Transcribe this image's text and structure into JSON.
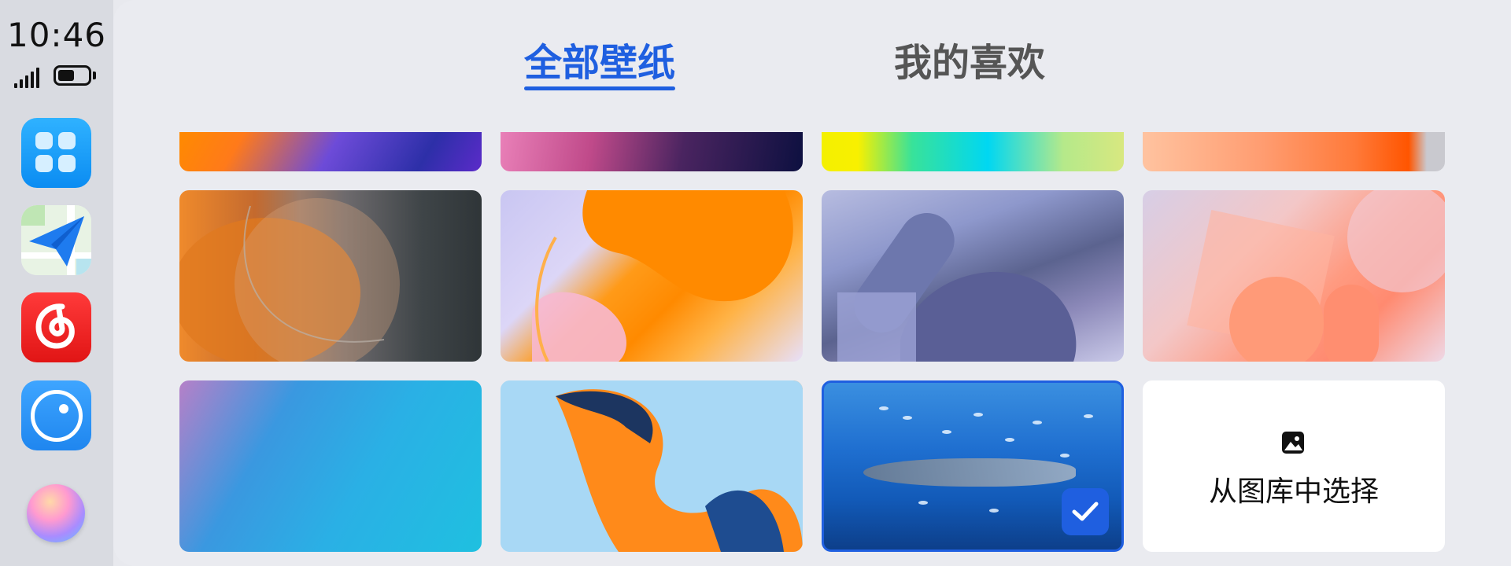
{
  "status": {
    "time": "10:46",
    "signal_icon": "signal-icon",
    "battery_icon": "battery-icon"
  },
  "dock": {
    "apps": [
      {
        "name": "apps-grid",
        "icon": "grid-icon"
      },
      {
        "name": "navigation",
        "icon": "paper-plane-icon"
      },
      {
        "name": "music",
        "icon": "netease-music-icon"
      },
      {
        "name": "camera",
        "icon": "camera-icon"
      },
      {
        "name": "assistant",
        "icon": "assistant-orb-icon"
      }
    ]
  },
  "tabs": [
    {
      "label": "全部壁纸",
      "active": true
    },
    {
      "label": "我的喜欢",
      "active": false
    }
  ],
  "wallpapers": {
    "selected": "aquarium-whale-shark",
    "pick_from_gallery": {
      "label": "从图库中选择",
      "icon": "image-icon"
    }
  },
  "colors": {
    "accent": "#1f5fe0",
    "background": "#eaebf0",
    "dock": "#d9dbe1"
  }
}
